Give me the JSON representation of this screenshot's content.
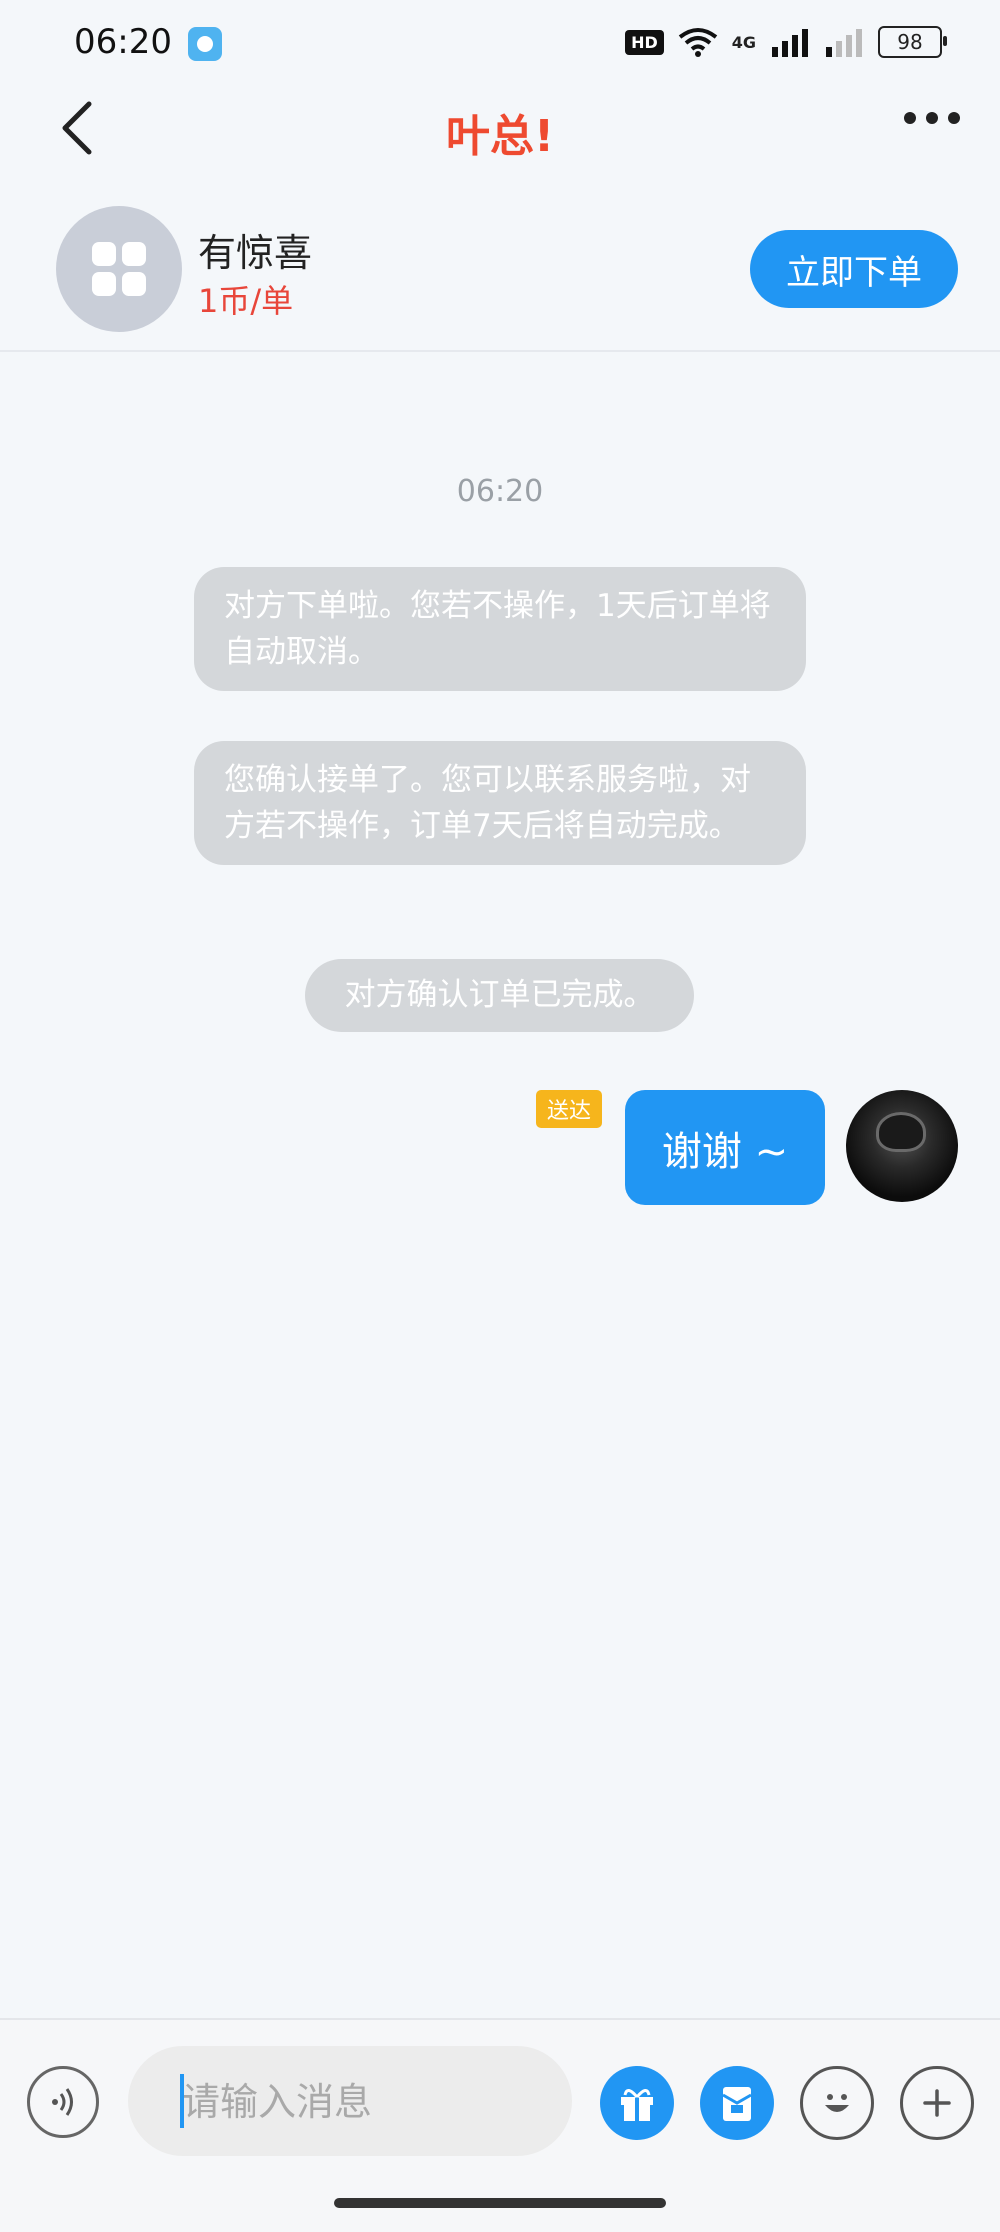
{
  "status_bar": {
    "time": "06:20",
    "network": "4G",
    "hd_label": "HD",
    "battery": "98"
  },
  "nav": {
    "title": "叶总!"
  },
  "service": {
    "name": "有惊喜",
    "price": "1币/单",
    "order_button": "立即下单"
  },
  "chat": {
    "timestamp": "06:20",
    "system_messages": [
      "对方下单啦。您若不操作，1天后订单将自动取消。",
      "您确认接单了。您可以联系服务啦，对方若不操作，订单7天后将自动完成。",
      "对方确认订单已完成。"
    ],
    "my_message": {
      "status": "送达",
      "text": "谢谢 ~"
    }
  },
  "input": {
    "placeholder": "请输入消息"
  },
  "colors": {
    "accent": "#2196f3",
    "title_red": "#ee4a30",
    "price_red": "#e8463a",
    "badge_yellow": "#f6b51c",
    "system_bubble": "#d4d7da"
  },
  "icons": [
    "back-arrow-icon",
    "more-icon",
    "grid-icon",
    "voice-icon",
    "gift-icon",
    "red-packet-icon",
    "emoji-icon",
    "plus-icon",
    "wifi-icon",
    "signal-icon"
  ]
}
